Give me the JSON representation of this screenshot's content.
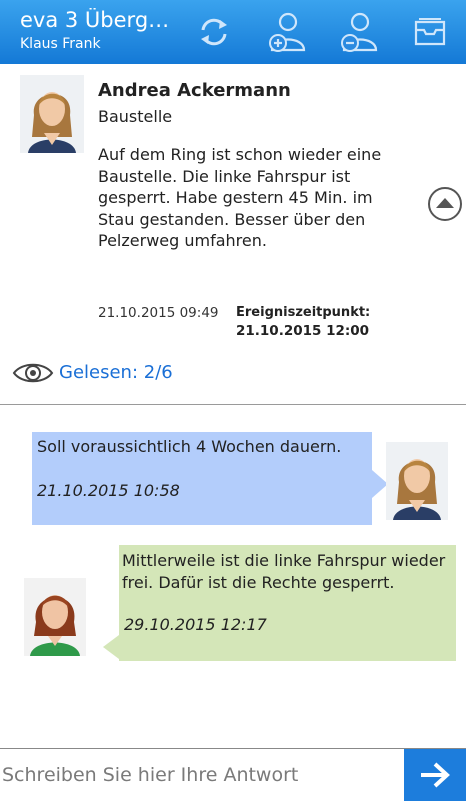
{
  "header": {
    "title": "eva 3 Überg…",
    "user": "Klaus Frank",
    "icons": [
      "sync-icon",
      "add-user-icon",
      "remove-user-icon",
      "archive-icon"
    ]
  },
  "post": {
    "author": "Andrea Ackermann",
    "subject": "Baustelle",
    "body": "Auf dem Ring ist schon wieder eine Baustelle. Die linke Fahrspur ist gesperrt. Habe gestern 45 Min. im Stau gestanden. Besser über den Pelzerweg umfahren.",
    "date": "21.10.2015 09:49",
    "event_label": "Ereigniszeitpunkt:",
    "event_value": "21.10.2015 12:00",
    "read_status": "Gelesen: 2/6"
  },
  "messages": [
    {
      "text": "Soll voraussichtlich 4 Wochen dauern.",
      "time": "21.10.2015 10:58",
      "color": "#b3cdfb"
    },
    {
      "text": "Mittlerweile ist die linke Fahrspur wieder frei. Dafür ist die Rechte gesperrt.",
      "time": "29.10.2015 12:17",
      "color": "#d4e6b8"
    }
  ],
  "reply": {
    "placeholder": "Schreiben Sie hier Ihre Antwort"
  },
  "colors": {
    "accent": "#1d7ddc",
    "link": "#1a6fd6"
  }
}
